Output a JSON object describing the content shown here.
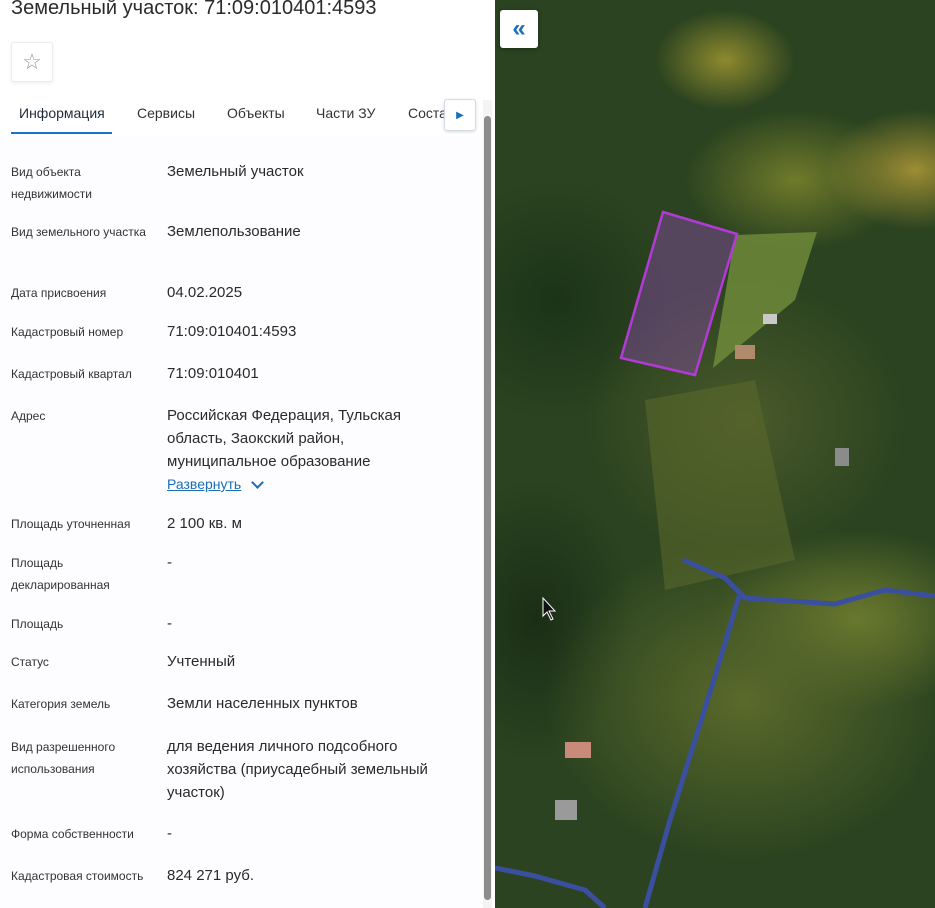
{
  "header": {
    "title": "Земельный участок: 71:09:010401:4593",
    "favorite_icon": "star-icon"
  },
  "tabs": [
    {
      "label": "Информация",
      "active": true
    },
    {
      "label": "Сервисы",
      "active": false
    },
    {
      "label": "Объекты",
      "active": false
    },
    {
      "label": "Части ЗУ",
      "active": false
    },
    {
      "label": "Состав ЕЗП",
      "active": false
    }
  ],
  "tabs_next_icon": "caret-right-icon",
  "info": [
    {
      "label": "Вид объекта недвижимости",
      "value": "Земельный участок"
    },
    {
      "label": "Вид земельного участка",
      "value": "Землепользование"
    },
    {
      "label": "Дата присвоения",
      "value": "04.02.2025"
    },
    {
      "label": "Кадастровый номер",
      "value": "71:09:010401:4593"
    },
    {
      "label": "Кадастровый квартал",
      "value": "71:09:010401"
    },
    {
      "label": "Адрес",
      "value": "Российская Федерация, Тульская область, Заокский район, муниципальное образование"
    },
    {
      "label": "Площадь уточненная",
      "value": "2 100 кв. м"
    },
    {
      "label": "Площадь декларированная",
      "value": "-"
    },
    {
      "label": "Площадь",
      "value": "-"
    },
    {
      "label": "Статус",
      "value": "Учтенный"
    },
    {
      "label": "Категория земель",
      "value": "Земли населенных пунктов"
    },
    {
      "label": "Вид разрешенного использования",
      "value": "для ведения личного подсобного хозяйства (приусадебный земельный участок)"
    },
    {
      "label": "Форма собственности",
      "value": "-"
    },
    {
      "label": "Кадастровая стоимость",
      "value": "824 271 руб."
    }
  ],
  "address_expand": "Развернуть",
  "map": {
    "collapse_label": "«",
    "parcel_color": "#b23ad6",
    "road_color": "#3a4f9e"
  }
}
